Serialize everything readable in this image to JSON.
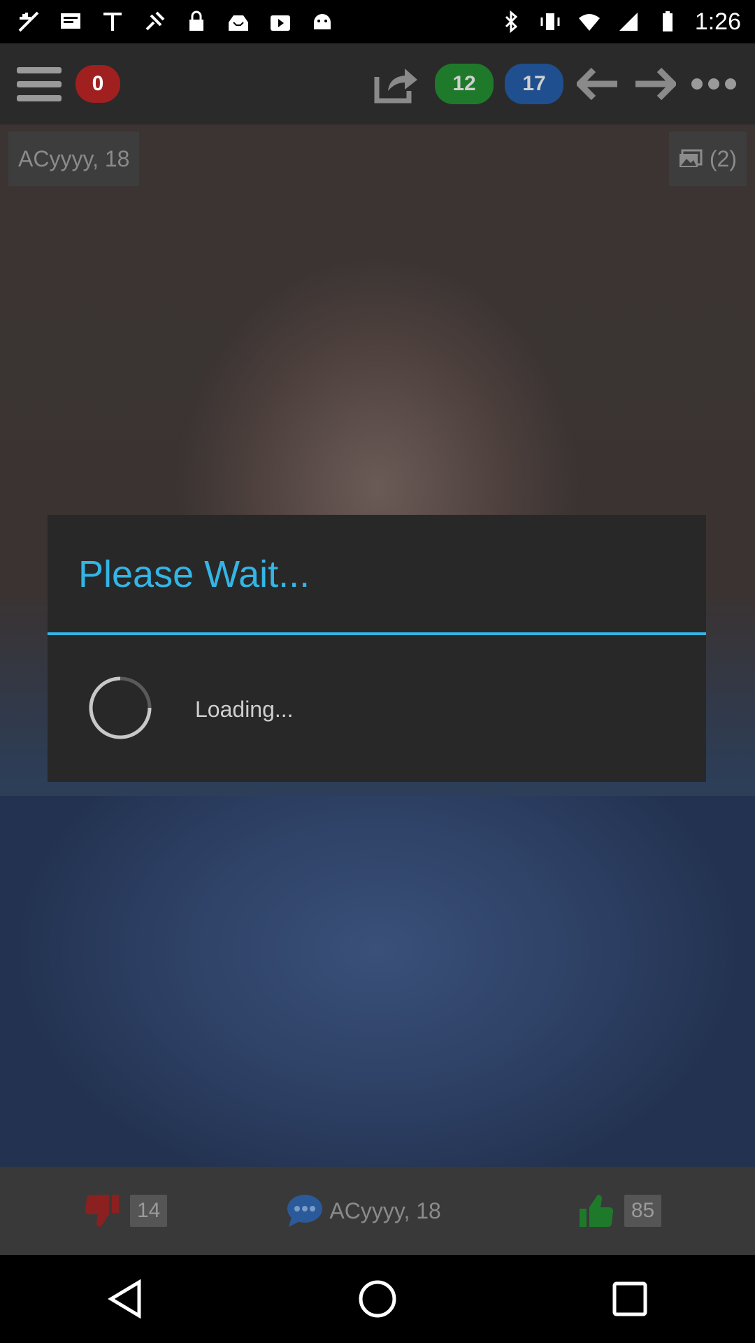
{
  "status_bar": {
    "time": "1:26",
    "left_icons": [
      "nav-app-icon",
      "screenshot-icon",
      "satellite-icon",
      "fake-gps-icon",
      "lock-icon",
      "inbox-icon",
      "play-store-icon",
      "android-icon"
    ],
    "right_icons": [
      "bluetooth-icon",
      "vibrate-icon",
      "wifi-icon",
      "signal-icon",
      "battery-icon"
    ]
  },
  "toolbar": {
    "notifications_count": "0",
    "green_count": "12",
    "blue_count": "17",
    "colors": {
      "red": "#a02020",
      "green": "#1e7a2a",
      "blue": "#1f4f8f"
    }
  },
  "profile": {
    "name_tag": "ACyyyy, 18",
    "photos_label": "(2)"
  },
  "dialog": {
    "title": "Please Wait...",
    "message": "Loading...",
    "accent": "#33b5e5"
  },
  "bottom_bar": {
    "dislike_count": "14",
    "chat_name": "ACyyyy, 18",
    "like_count": "85"
  }
}
